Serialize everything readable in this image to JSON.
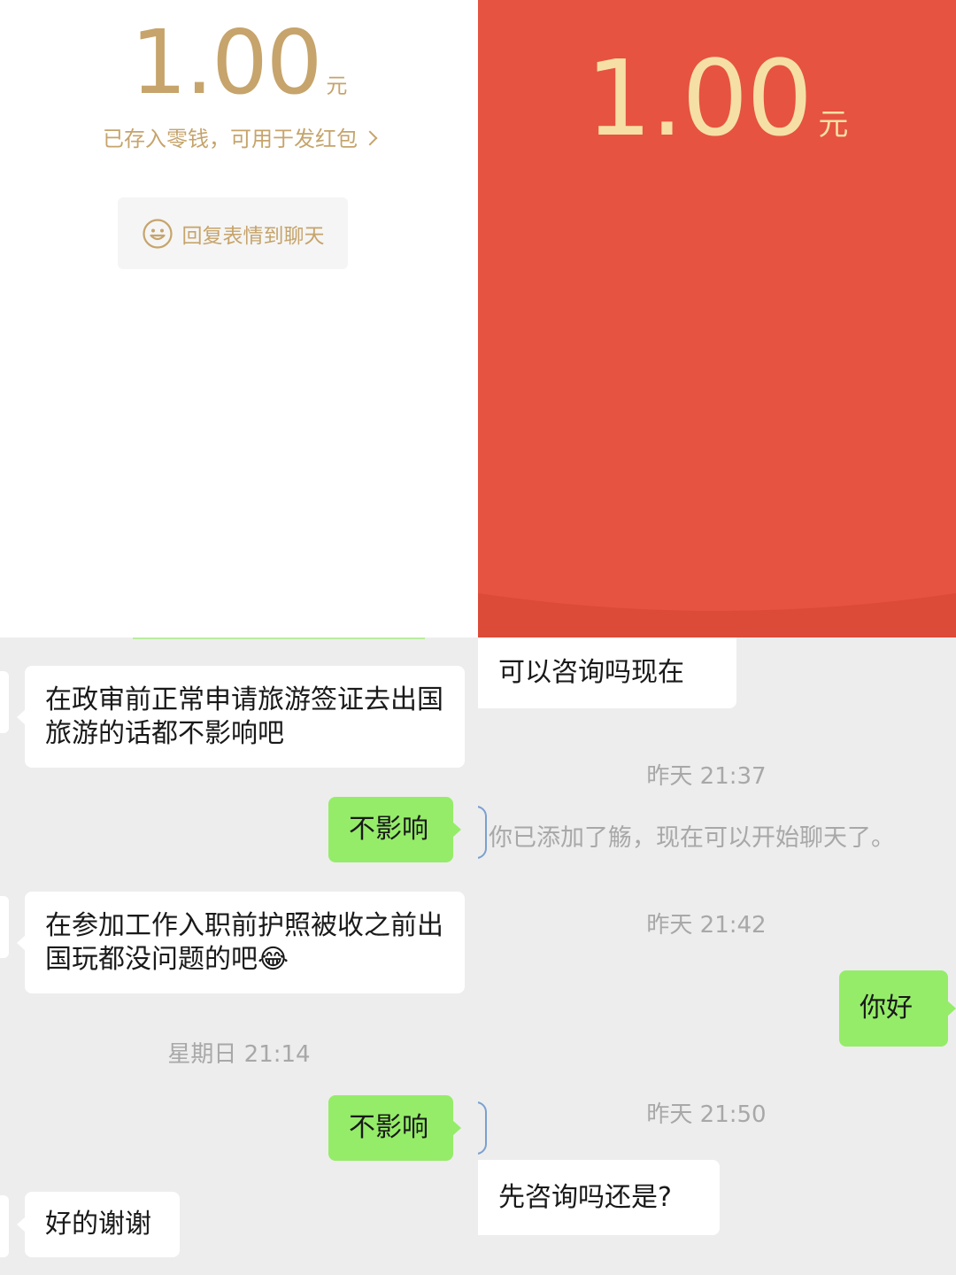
{
  "red_packet_detail": {
    "amount": "1.00",
    "unit": "元",
    "saved_text": "已存入零钱，可用于发红包",
    "reply_button": "回复表情到聊天",
    "colors": {
      "gold": "#c6a46b",
      "button_bg": "#f5f5f5"
    }
  },
  "red_packet_envelope": {
    "amount": "1.00",
    "unit": "元",
    "colors": {
      "background": "#e65340",
      "amount": "#f6dfa5"
    }
  },
  "chat_left": {
    "messages": [
      {
        "side": "received",
        "text": "在政审前正常申请旅游签证去出国旅游的话都不影响吧"
      },
      {
        "side": "sent",
        "text": "不影响"
      },
      {
        "side": "received",
        "text": "在参加工作入职前护照被收之前出国玩都没问题的吧😂"
      },
      {
        "side": "time",
        "text": "星期日 21:14"
      },
      {
        "side": "sent",
        "text": "不影响"
      },
      {
        "side": "received",
        "text": "好的谢谢"
      }
    ]
  },
  "chat_right": {
    "messages": [
      {
        "side": "received",
        "text": "可以咨询吗现在"
      },
      {
        "side": "time",
        "text": "昨天 21:37"
      },
      {
        "side": "system",
        "text": "你已添加了觞，现在可以开始聊天了。"
      },
      {
        "side": "time",
        "text": "昨天 21:42"
      },
      {
        "side": "sent",
        "text": "你好"
      },
      {
        "side": "time",
        "text": "昨天 21:50"
      },
      {
        "side": "received",
        "text": "先咨询吗还是?"
      }
    ]
  },
  "colors": {
    "chat_bg": "#ededed",
    "sent_bubble": "#95ec69",
    "received_bubble": "#ffffff"
  }
}
